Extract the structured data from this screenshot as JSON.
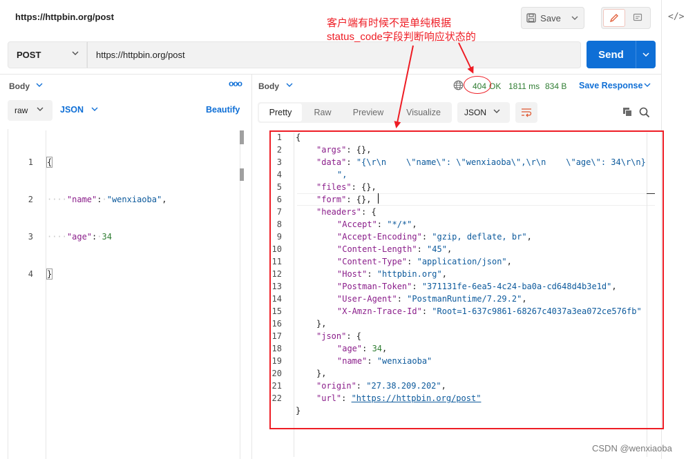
{
  "header": {
    "title": "https://httpbin.org/post",
    "save_label": "Save",
    "code_icon_label": "</>"
  },
  "request": {
    "method": "POST",
    "url": "https://httpbin.org/post",
    "send_label": "Send",
    "body_tab_label": "Body",
    "more_label": "ooo",
    "body_mode": "raw",
    "body_language": "JSON",
    "beautify_label": "Beautify",
    "line_numbers": [
      "1",
      "2",
      "3",
      "4"
    ],
    "body_tokens": {
      "open": "{",
      "name_key": "\"name\"",
      "colon": ":",
      "name_value": "\"wenxiaoba\"",
      "comma": ",",
      "age_key": "\"age\"",
      "age_value": "34",
      "close": "}"
    }
  },
  "response": {
    "body_tab_label": "Body",
    "status_code": "404",
    "status_text": "OK",
    "time": "1811 ms",
    "size": "834 B",
    "save_response_label": "Save Response",
    "view_tabs": [
      "Pretty",
      "Raw",
      "Preview",
      "Visualize"
    ],
    "format": "JSON",
    "line_numbers": [
      "1",
      "2",
      "3",
      "4",
      "5",
      "6",
      "7",
      "8",
      "9",
      "10",
      "11",
      "12",
      "13",
      "14",
      "15",
      "16",
      "17",
      "18",
      "19",
      "20",
      "21",
      "22"
    ],
    "lines": [
      {
        "indent": 0,
        "text": "{"
      },
      {
        "indent": 1,
        "key": "\"args\"",
        "rest": ": {},"
      },
      {
        "indent": 1,
        "key": "\"data\"",
        "rest": ": ",
        "str": "\"{\\r\\n    \\\"name\\\": \\\"wenxiaoba\\\",\\r\\n    \\\"age\\\": 34\\r\\n}"
      },
      {
        "indent": 1,
        "cont": "\","
      },
      {
        "indent": 1,
        "key": "\"files\"",
        "rest": ": {},"
      },
      {
        "indent": 1,
        "key": "\"form\"",
        "rest": ": {},"
      },
      {
        "indent": 1,
        "key": "\"headers\"",
        "rest": ": {"
      },
      {
        "indent": 2,
        "key": "\"Accept\"",
        "rest": ": ",
        "str": "\"*/*\"",
        "tail": ","
      },
      {
        "indent": 2,
        "key": "\"Accept-Encoding\"",
        "rest": ": ",
        "str": "\"gzip, deflate, br\"",
        "tail": ","
      },
      {
        "indent": 2,
        "key": "\"Content-Length\"",
        "rest": ": ",
        "str": "\"45\"",
        "tail": ","
      },
      {
        "indent": 2,
        "key": "\"Content-Type\"",
        "rest": ": ",
        "str": "\"application/json\"",
        "tail": ","
      },
      {
        "indent": 2,
        "key": "\"Host\"",
        "rest": ": ",
        "str": "\"httpbin.org\"",
        "tail": ","
      },
      {
        "indent": 2,
        "key": "\"Postman-Token\"",
        "rest": ": ",
        "str": "\"371131fe-6ea5-4c24-ba0a-cd648d4b3e1d\"",
        "tail": ","
      },
      {
        "indent": 2,
        "key": "\"User-Agent\"",
        "rest": ": ",
        "str": "\"PostmanRuntime/7.29.2\"",
        "tail": ","
      },
      {
        "indent": 2,
        "key": "\"X-Amzn-Trace-Id\"",
        "rest": ": ",
        "str": "\"Root=1-637c9861-68267c4037a3ea072ce576fb\""
      },
      {
        "indent": 1,
        "text": "},"
      },
      {
        "indent": 1,
        "key": "\"json\"",
        "rest": ": {"
      },
      {
        "indent": 2,
        "key": "\"age\"",
        "rest": ": ",
        "num": "34",
        "tail": ","
      },
      {
        "indent": 2,
        "key": "\"name\"",
        "rest": ": ",
        "str": "\"wenxiaoba\""
      },
      {
        "indent": 1,
        "text": "},"
      },
      {
        "indent": 1,
        "key": "\"origin\"",
        "rest": ": ",
        "str": "\"27.38.209.202\"",
        "tail": ","
      },
      {
        "indent": 1,
        "key": "\"url\"",
        "rest": ": ",
        "link": "\"https://httpbin.org/post\""
      },
      {
        "indent": 0,
        "text": "}"
      }
    ]
  },
  "annotation": {
    "line1": "客户端有时候不是单纯根据",
    "line2": "status_code字段判断响应状态的"
  },
  "watermark": "CSDN @wenxiaoba",
  "colors": {
    "accent": "#0f6fd6",
    "status_ok": "#2f7d32",
    "annotation_red": "#ee1c24"
  }
}
